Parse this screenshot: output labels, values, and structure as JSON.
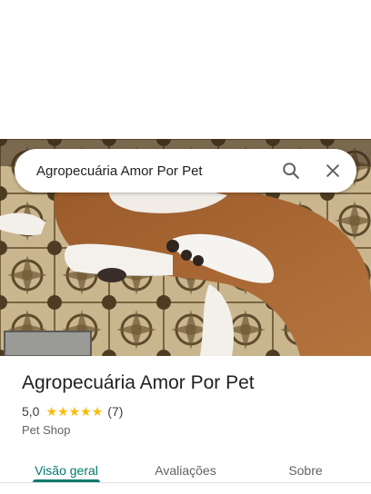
{
  "search": {
    "query": "Agropecuária Amor Por Pet"
  },
  "icons": {
    "search": "search-icon",
    "close": "close-icon",
    "star": "star-icon"
  },
  "place": {
    "name": "Agropecuária Amor Por Pet",
    "rating": "5,0",
    "stars": 5,
    "reviews_count": "(7)",
    "category": "Pet Shop"
  },
  "tabs": [
    {
      "label": "Visão geral",
      "active": true
    },
    {
      "label": "Avaliações",
      "active": false
    },
    {
      "label": "Sobre",
      "active": false
    }
  ],
  "colors": {
    "accent": "#00796b",
    "star": "#fbbc04",
    "text": "#202124",
    "secondary": "#5f6368"
  }
}
